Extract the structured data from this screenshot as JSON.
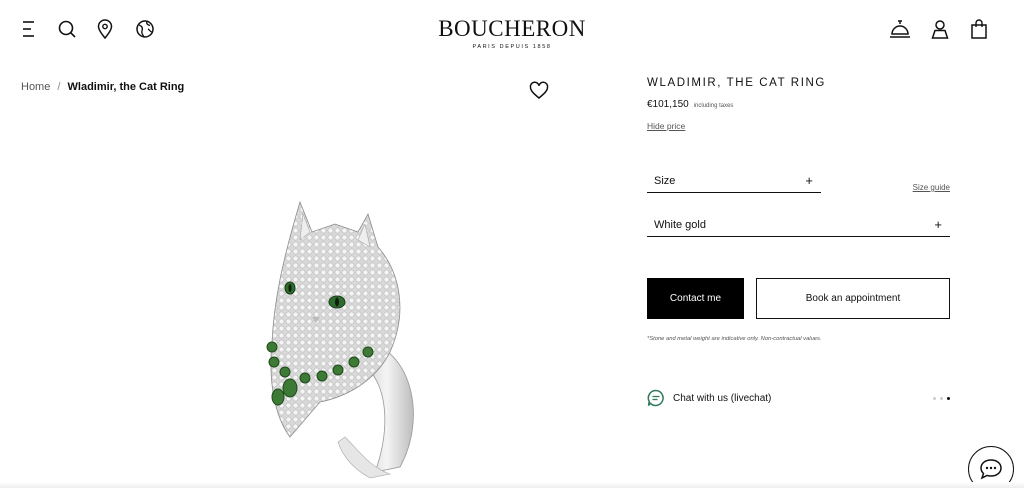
{
  "header": {
    "icons": [
      "menu-icon",
      "search-icon",
      "store-locator-icon",
      "globe-icon",
      "concierge-bell-icon",
      "account-icon",
      "shopping-bag-icon"
    ],
    "logo": {
      "name": "BOUCHERON",
      "tagline": "PARIS DEPUIS 1858"
    }
  },
  "breadcrumb": {
    "home": "Home",
    "separator": "/",
    "current": "Wladimir, the Cat Ring"
  },
  "product": {
    "title": "WLADIMIR, THE CAT RING",
    "price": "€101,150",
    "tax_note": "including taxes",
    "hide_price": "Hide price",
    "size_label": "Size",
    "size_guide": "Size guide",
    "metal_label": "White gold",
    "plus": "+",
    "contact_button": "Contact me",
    "appointment_button": "Book an appointment",
    "disclaimer": "*Stone and metal weight are indicative only. Non-contractual values.",
    "chat_label": "Chat with us (livechat)"
  },
  "colors": {
    "accent_green": "#2f7a5a",
    "black": "#000000",
    "gem_green": "#2e6b2c"
  }
}
